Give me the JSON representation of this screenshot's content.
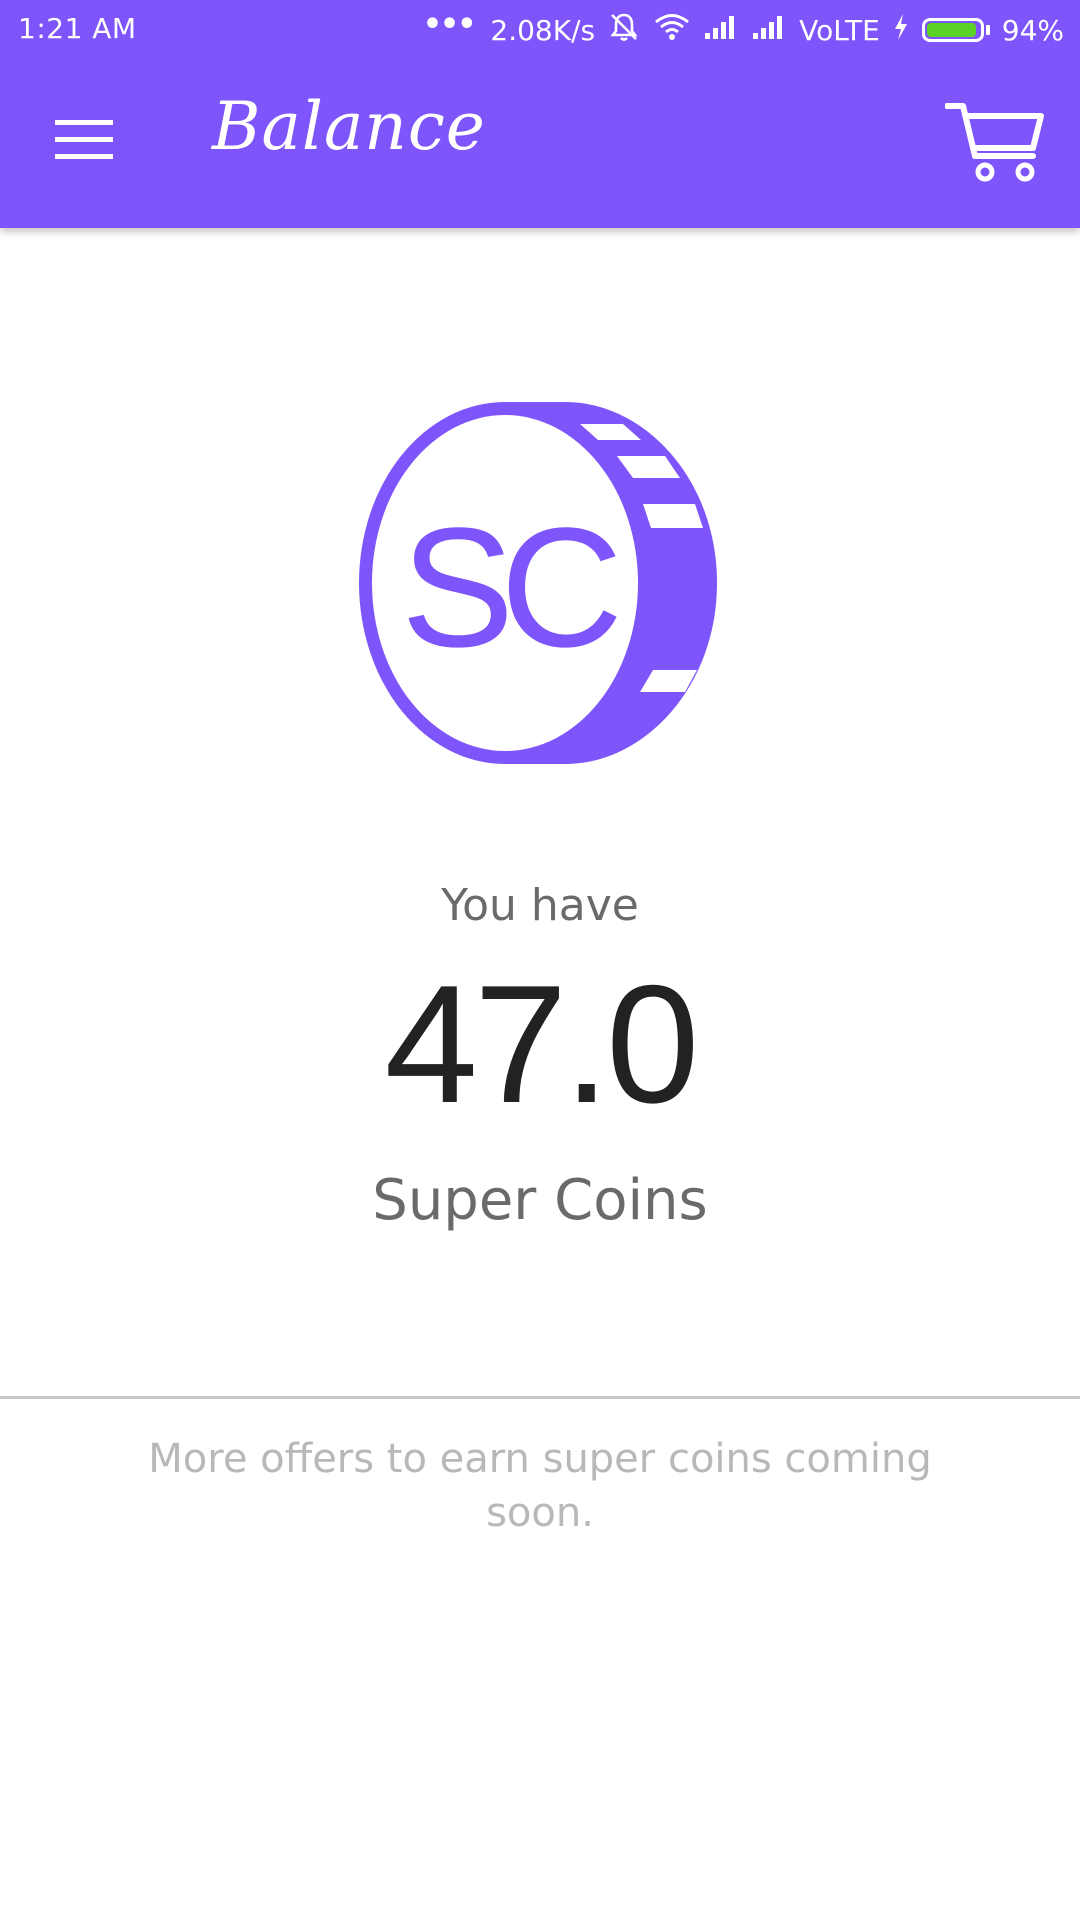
{
  "status_bar": {
    "time": "1:21 AM",
    "network_speed": "2.08K/s",
    "carrier_label": "VoLTE",
    "battery_percent": "94%",
    "battery_level": 0.94,
    "battery_color": "#5bd126"
  },
  "app_bar": {
    "title": "Balance",
    "menu_icon": "hamburger-menu-icon",
    "cart_icon": "shopping-cart-icon",
    "background_color": "#7e55fb"
  },
  "balance": {
    "logo_text": "SC",
    "intro": "You have",
    "amount": "47.0",
    "currency": "Super Coins"
  },
  "footer": {
    "note": "More offers to earn super coins coming soon."
  },
  "colors": {
    "accent": "#7e55fb",
    "primary_text": "#222222",
    "secondary_text": "#6a6a6a",
    "muted_text": "#b8b8b8"
  }
}
